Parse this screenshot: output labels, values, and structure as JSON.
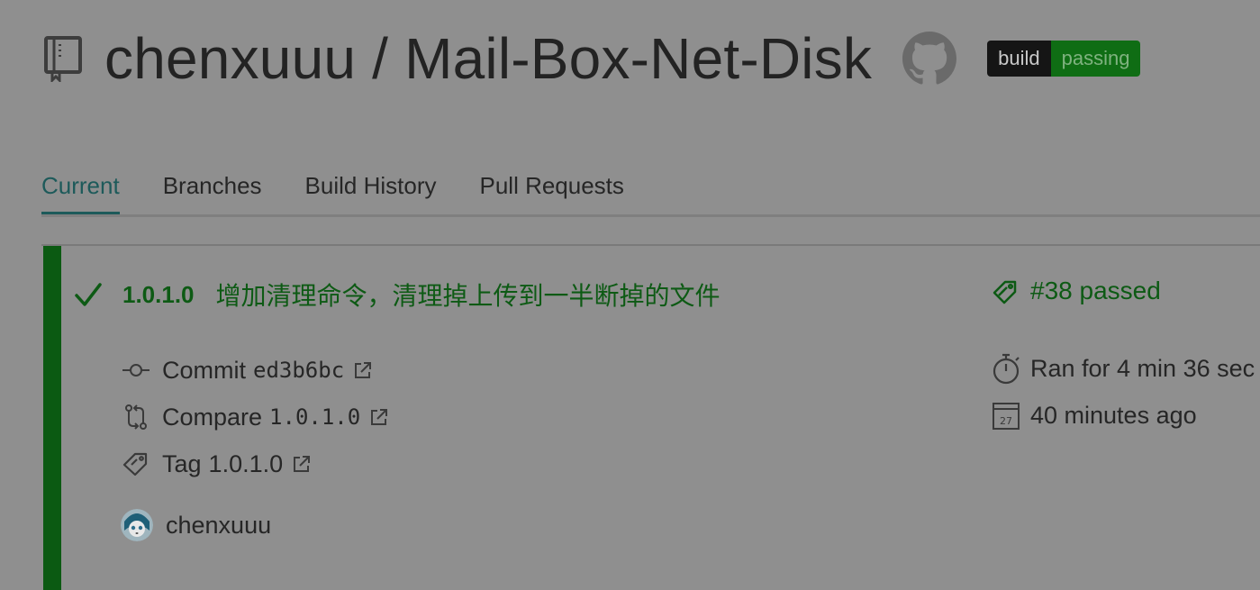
{
  "header": {
    "repo_title": "chenxuuu / Mail-Box-Net-Disk",
    "badge": {
      "left": "build",
      "right": "passing"
    }
  },
  "tabs": [
    {
      "label": "Current",
      "active": true
    },
    {
      "label": "Branches",
      "active": false
    },
    {
      "label": "Build History",
      "active": false
    },
    {
      "label": "Pull Requests",
      "active": false
    }
  ],
  "build": {
    "version": "1.0.1.0",
    "message": "增加清理命令，清理掉上传到一半断掉的文件",
    "status": "#38 passed",
    "commit_label": "Commit",
    "commit_hash": "ed3b6bc",
    "compare_label": "Compare",
    "compare_value": "1.0.1.0",
    "tag_label": "Tag",
    "tag_value": "1.0.1.0",
    "author": "chenxuuu",
    "duration": "Ran for 4 min 36 sec",
    "finished": "40 minutes ago",
    "calendar_day": "27"
  },
  "colors": {
    "success": "#0d5a14",
    "stripe": "#0b5a12",
    "active_tab": "#1d5a5a"
  }
}
